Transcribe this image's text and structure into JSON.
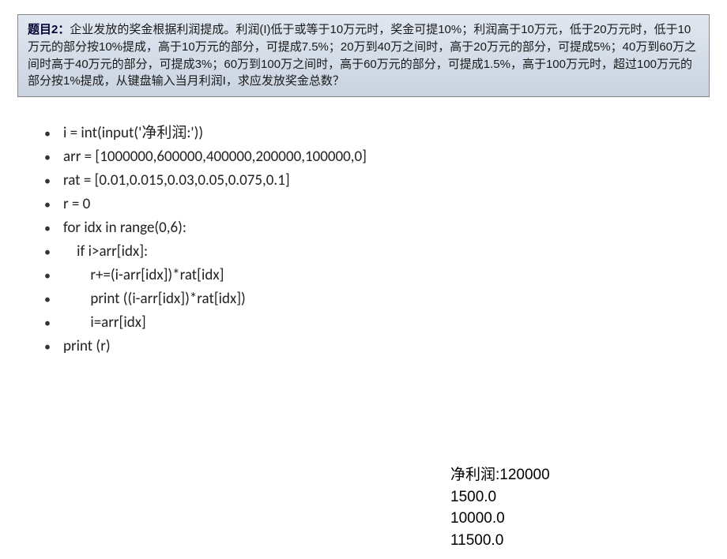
{
  "problem": {
    "title_label": "题目2：",
    "description": "企业发放的奖金根据利润提成。利润(I)低于或等于10万元时，奖金可提10%；利润高于10万元，低于20万元时，低于10万元的部分按10%提成，高于10万元的部分，可提成7.5%；20万到40万之间时，高于20万元的部分，可提成5%；40万到60万之间时高于40万元的部分，可提成3%；60万到100万之间时，高于60万元的部分，可提成1.5%，高于100万元时，超过100万元的部分按1%提成，从键盘输入当月利润I，求应发放奖金总数？"
  },
  "code": {
    "lines": [
      "i = int(input('净利润:'))",
      "arr = [1000000,600000,400000,200000,100000,0]",
      "rat = [0.01,0.015,0.03,0.05,0.075,0.1]",
      "r = 0",
      "for idx in range(0,6):",
      "    if i>arr[idx]:",
      "        r+=(i-arr[idx])*rat[idx]",
      "        print ((i-arr[idx])*rat[idx])",
      "        i=arr[idx]",
      "print (r)"
    ]
  },
  "output": {
    "lines": [
      "净利润:120000",
      "1500.0",
      "10000.0",
      "11500.0"
    ]
  }
}
